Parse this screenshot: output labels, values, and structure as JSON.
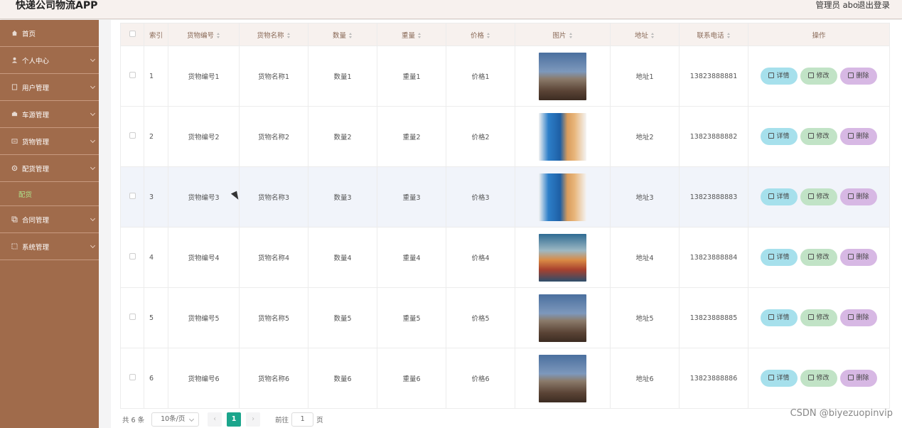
{
  "app": {
    "title": "快递公司物流APP"
  },
  "header": {
    "admin": "管理员 abo",
    "logout": "退出登录"
  },
  "sidebar": {
    "items": [
      {
        "label": "首页",
        "icon": "home-icon"
      },
      {
        "label": "个人中心",
        "icon": "user-icon"
      },
      {
        "label": "用户管理",
        "icon": "document-icon"
      },
      {
        "label": "车源管理",
        "icon": "truck-icon"
      },
      {
        "label": "货物管理",
        "icon": "box-icon"
      },
      {
        "label": "配货管理",
        "icon": "gear-icon"
      },
      {
        "label": "合同管理",
        "icon": "copy-icon"
      },
      {
        "label": "系统管理",
        "icon": "settings-icon"
      }
    ],
    "submenu_label": "配货"
  },
  "table": {
    "headers": [
      "",
      "索引",
      "货物编号",
      "货物名称",
      "数量",
      "重量",
      "价格",
      "图片",
      "地址",
      "联系电话",
      "操作"
    ],
    "rows": [
      {
        "index": "1",
        "code": "货物编号1",
        "name": "货物名称1",
        "qty": "数量1",
        "weight": "重量1",
        "price": "价格1",
        "image": "warehouse-photo",
        "address": "地址1",
        "phone": "13823888881"
      },
      {
        "index": "2",
        "code": "货物编号2",
        "name": "货物名称2",
        "qty": "数量2",
        "weight": "重量2",
        "price": "价格2",
        "image": "delivery-photo",
        "address": "地址2",
        "phone": "13823888882"
      },
      {
        "index": "3",
        "code": "货物编号3",
        "name": "货物名称3",
        "qty": "数量3",
        "weight": "重量3",
        "price": "价格3",
        "image": "delivery-photo",
        "address": "地址3",
        "phone": "13823888883"
      },
      {
        "index": "4",
        "code": "货物编号4",
        "name": "货物名称4",
        "qty": "数量4",
        "weight": "重量4",
        "price": "价格4",
        "image": "port-photo",
        "address": "地址4",
        "phone": "13823888884"
      },
      {
        "index": "5",
        "code": "货物编号5",
        "name": "货物名称5",
        "qty": "数量5",
        "weight": "重量5",
        "price": "价格5",
        "image": "warehouse-photo",
        "address": "地址5",
        "phone": "13823888885"
      },
      {
        "index": "6",
        "code": "货物编号6",
        "name": "货物名称6",
        "qty": "数量6",
        "weight": "重量6",
        "price": "价格6",
        "image": "warehouse-photo",
        "address": "地址6",
        "phone": "13823888886"
      }
    ],
    "actions": {
      "detail": "详情",
      "edit": "修改",
      "delete": "删除"
    }
  },
  "pagination": {
    "total": "共 6 条",
    "page_size": "10条/页",
    "prev": "‹",
    "current": "1",
    "next": "›",
    "goto": "前往",
    "goto_value": "1",
    "page_unit": "页"
  },
  "watermark": "CSDN @biyezuopinvip",
  "colors": {
    "sidebar": "#a06b4b",
    "accent": "#1ba58c",
    "header": "#f7f1ee",
    "detail_btn": "#a6e0ec",
    "edit_btn": "#c1e3c6",
    "delete_btn": "#d7b8e4",
    "submenu_active": "#aee08a"
  }
}
